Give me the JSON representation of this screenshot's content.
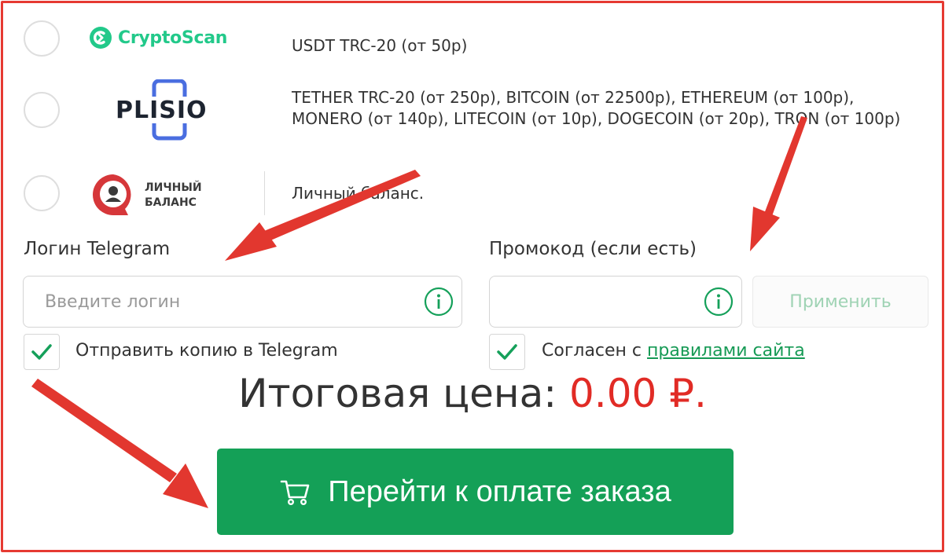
{
  "payment_methods": [
    {
      "logo_text": "CryptoScan",
      "description": "USDT TRC-20 (от 50р)"
    },
    {
      "logo_text": "PLISIO",
      "description": "TETHER TRC-20 (от 250р), BITCOIN (от 22500р), ETHEREUM (от 100р), MONERO (от 140р), LITECOIN (от 10р), DOGECOIN (от 20р), TRON (от 100р)"
    },
    {
      "logo_line1": "ЛИЧНЫЙ",
      "logo_line2": "БАЛАНС",
      "description": "Личный баланс."
    }
  ],
  "telegram": {
    "label": "Логин Telegram",
    "placeholder": "Введите логин",
    "value": "",
    "send_copy_label": "Отправить копию в Telegram",
    "send_copy_checked": true
  },
  "promo": {
    "label": "Промокод (если есть)",
    "value": "",
    "apply_label": "Применить",
    "agree_prefix": "Согласен с ",
    "agree_link": "правилами сайта",
    "agree_checked": true
  },
  "total": {
    "label": "Итоговая цена: ",
    "price": "0.00 ₽."
  },
  "checkout": {
    "button_label": "Перейти к оплате заказа"
  },
  "colors": {
    "frame": "#e63a32",
    "accent_green": "#14a057",
    "price_red": "#e12b25",
    "annotation_arrow": "#e2372f"
  }
}
